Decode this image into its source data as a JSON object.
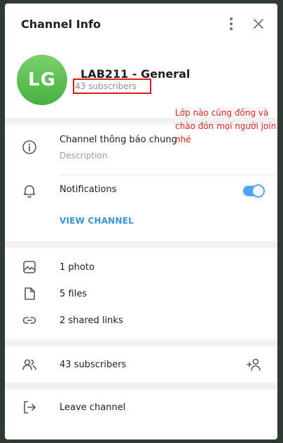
{
  "header": {
    "title": "Channel Info"
  },
  "profile": {
    "avatar_initials": "LG",
    "channel_name": "LAB211 - General",
    "subscribers_line": "43 subscribers"
  },
  "annotation": {
    "text": "Lớp nào cũng đồng và chào đón mọi người join nhé",
    "color": "#e0221f"
  },
  "info": {
    "description_value": "Channel thông báo chung",
    "description_label": "Description",
    "notifications_label": "Notifications",
    "notifications_on": true,
    "view_channel": "VIEW CHANNEL"
  },
  "media": {
    "photos": "1 photo",
    "files": "5 files",
    "links": "2 shared links"
  },
  "members": {
    "label": "43 subscribers"
  },
  "actions": {
    "leave": "Leave channel"
  },
  "colors": {
    "accent": "#4ea4f6",
    "link": "#3a95d8",
    "avatar": "#45b140"
  }
}
